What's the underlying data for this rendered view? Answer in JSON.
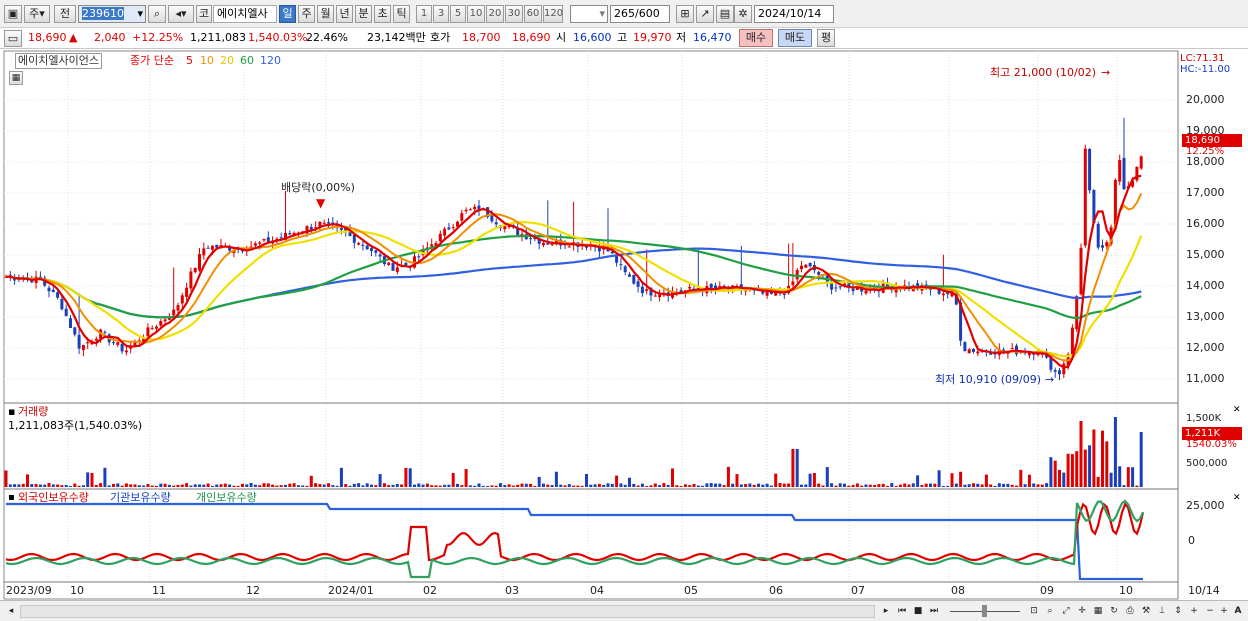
{
  "toolbar": {
    "period_type": "주",
    "prev_label": "전",
    "code": "239610",
    "stock_name": "에이치엘사",
    "market_flag": "코",
    "periods": [
      "일",
      "주",
      "월",
      "년",
      "분",
      "초",
      "틱"
    ],
    "selected_period": "일",
    "minute_options": [
      "1",
      "3",
      "5",
      "10",
      "20",
      "30",
      "60",
      "120"
    ],
    "count": "265",
    "count_max": "/600",
    "date": "2024/10/14"
  },
  "info": {
    "price": "18,690",
    "change": "2,040",
    "change_pct": "+12.25%",
    "volume": "1,211,083",
    "volume_pct": "1,540.03%",
    "turnover": "22.46%",
    "amount": "23,142백만",
    "bid_label": "호가",
    "bid1": "18,700",
    "bid2": "18,690",
    "open_label": "시",
    "open": "16,600",
    "high_label": "고",
    "high": "19,970",
    "low_label": "저",
    "low": "16,470",
    "buy_label": "매수",
    "sell_label": "매도",
    "eval_label": "평"
  },
  "legend": {
    "name": "에이치엘사이언스",
    "ma_label": "종가 단순",
    "ma_periods": [
      "5",
      "10",
      "20",
      "60",
      "120"
    ],
    "ma_colors": [
      "#e00000",
      "#f09000",
      "#f0e000",
      "#20a040",
      "#3060e0"
    ]
  },
  "annotations": {
    "high": "최고 21,000 (10/02)",
    "low": "최저 10,910 (09/09)",
    "dividend": "배당락(0,00%)"
  },
  "right_info": {
    "lc": "LC:71.31",
    "hc": "HC:-11.00",
    "price_flag": "18,690",
    "pct_flag": "12.25%"
  },
  "price_axis": [
    "20,000",
    "19,000",
    "18,000",
    "17,000",
    "16,000",
    "15,000",
    "14,000",
    "13,000",
    "12,000",
    "11,000"
  ],
  "volume_panel": {
    "title": "거래량",
    "value": "1,211,083주(1,540.03%)",
    "axis": [
      "1,500K",
      "500,000"
    ],
    "flag": "1,211K",
    "pct": "1540.03%"
  },
  "investor_panel": {
    "labels": [
      "외국인보유수량",
      "기관보유수량",
      "개인보유수량"
    ],
    "axis": [
      "25,000",
      "0"
    ]
  },
  "x_axis": [
    "2023/09",
    "10",
    "11",
    "12",
    "2024/01",
    "02",
    "03",
    "04",
    "05",
    "06",
    "07",
    "08",
    "09",
    "10",
    "10/14"
  ],
  "colors": {
    "up": "#e00000",
    "down": "#2050c0",
    "highlight": "#3c78c8"
  }
}
